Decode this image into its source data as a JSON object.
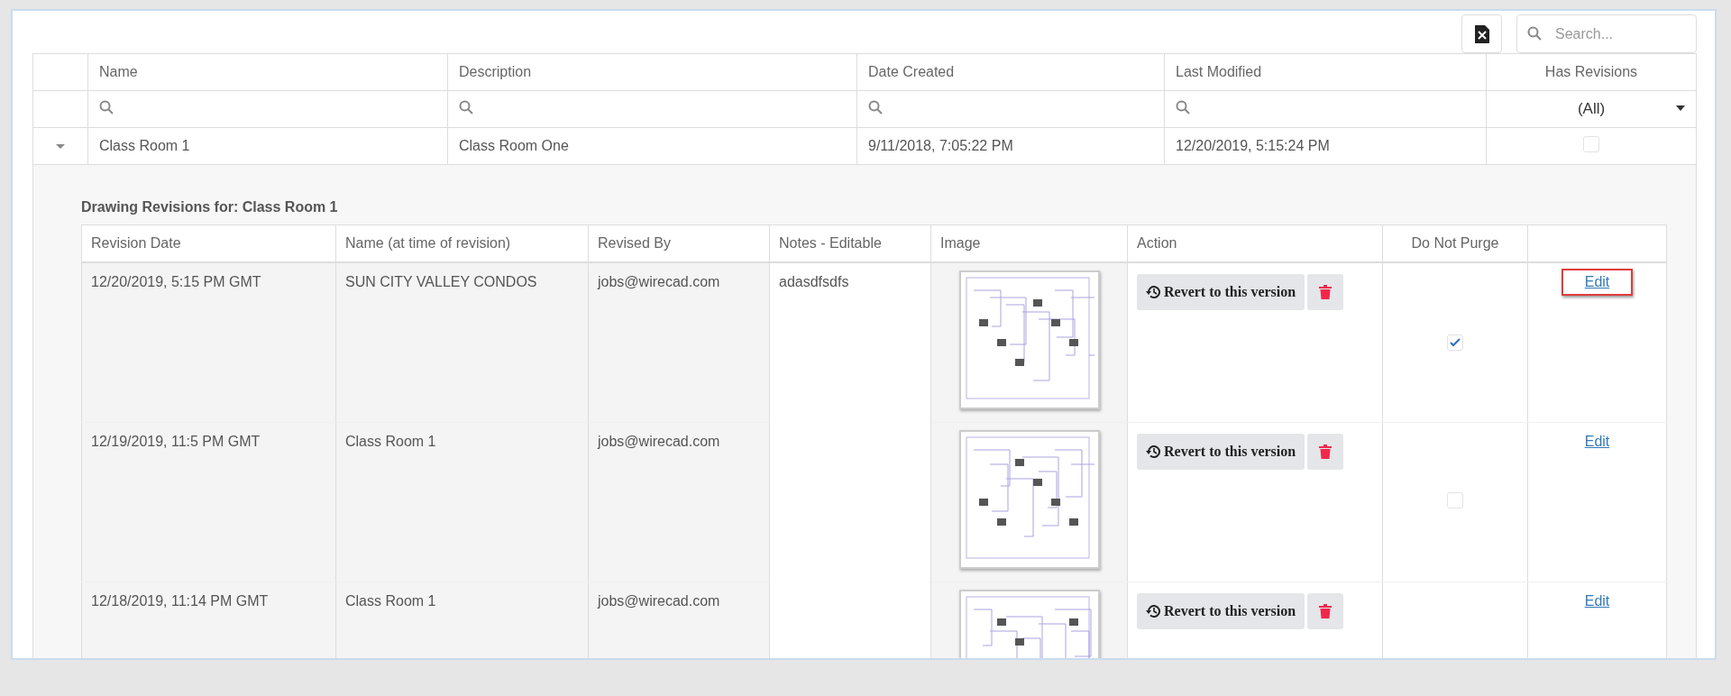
{
  "toolbar": {
    "search": {
      "placeholder": "Search..."
    }
  },
  "table": {
    "columns": [
      "Name",
      "Description",
      "Date Created",
      "Last Modified",
      "Has Revisions"
    ],
    "filters": [
      {
        "kind": "search"
      },
      {
        "kind": "search"
      },
      {
        "kind": "search"
      },
      {
        "kind": "search"
      },
      {
        "kind": "select",
        "value": "(All)"
      }
    ],
    "rows": [
      {
        "expanded": true,
        "cells": [
          "Class Room 1",
          "Class Room One",
          "9/11/2018, 7:05:22 PM",
          "12/20/2019, 5:15:24 PM"
        ],
        "has_revisions": false,
        "detail": {
          "title": "Drawing Revisions for: Class Room 1",
          "columns": [
            "Revision Date",
            "Name (at time of revision)",
            "Revised By",
            "Notes - Editable",
            "Image",
            "Action",
            "Do Not Purge"
          ],
          "rows": [
            {
              "revision_date": "12/20/2019, 5:15 PM GMT",
              "name": "SUN CITY VALLEY CONDOS",
              "revised_by": "jobs@wirecad.com",
              "notes": "adasdfsdfs",
              "action_label": "Revert to this version",
              "do_not_purge": true,
              "edit_label": "Edit",
              "highlighted": true
            },
            {
              "revision_date": "12/19/2019, 11:5 PM GMT",
              "name": "Class Room 1",
              "revised_by": "jobs@wirecad.com",
              "action_label": "Revert to this version",
              "do_not_purge": false,
              "edit_label": "Edit",
              "highlighted": false
            },
            {
              "revision_date": "12/18/2019, 11:14 PM GMT",
              "name": "Class Room 1",
              "revised_by": "jobs@wirecad.com",
              "action_label": "Revert to this version",
              "edit_label": "Edit",
              "highlighted": false
            }
          ]
        }
      }
    ]
  }
}
